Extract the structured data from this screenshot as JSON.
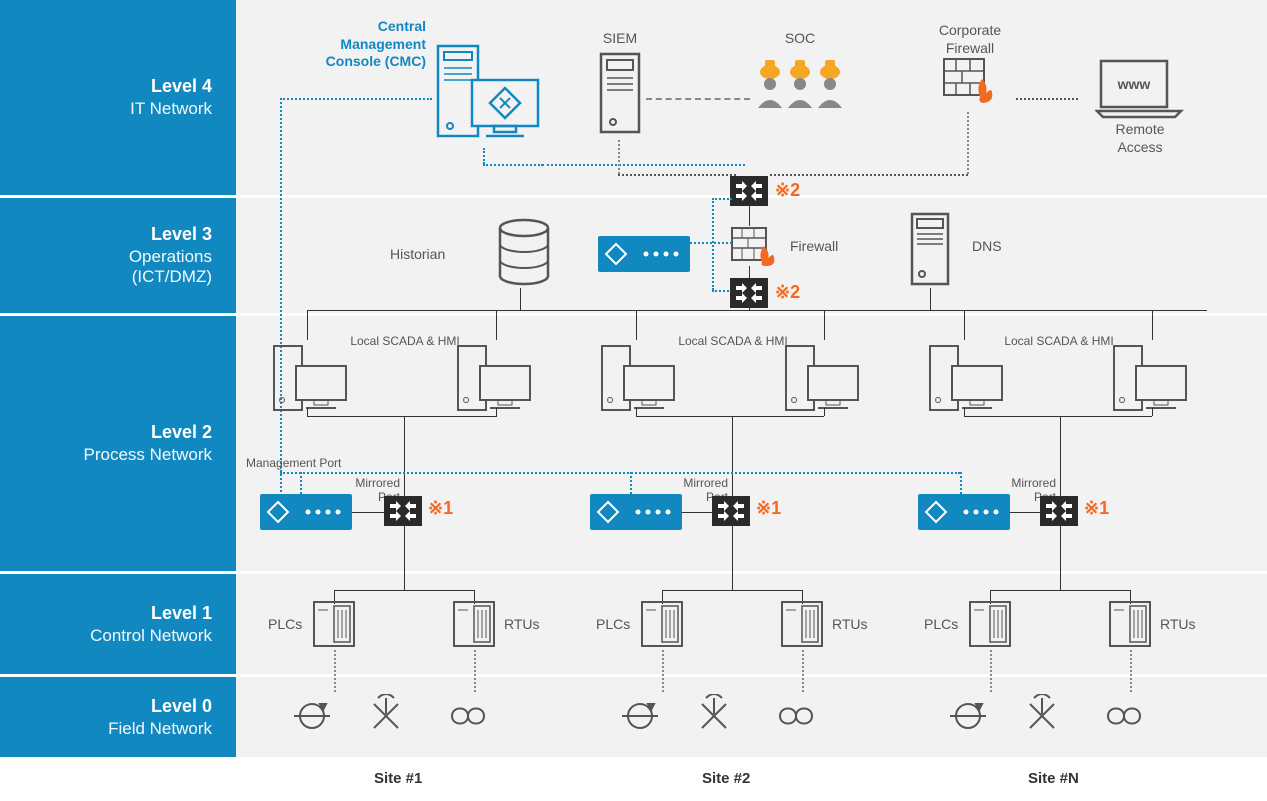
{
  "levels": {
    "l4": {
      "title": "Level 4",
      "subtitle": "IT Network"
    },
    "l3": {
      "title": "Level 3",
      "subtitle1": "Operations",
      "subtitle2": "(ICT/DMZ)"
    },
    "l2": {
      "title": "Level 2",
      "subtitle": "Process Network"
    },
    "l1": {
      "title": "Level 1",
      "subtitle": "Control Network"
    },
    "l0": {
      "title": "Level 0",
      "subtitle": "Field Network"
    }
  },
  "nodes": {
    "cmc": {
      "line1": "Central",
      "line2": "Management",
      "line3": "Console (CMC)"
    },
    "siem": "SIEM",
    "soc": "SOC",
    "corp_fw": {
      "line1": "Corporate",
      "line2": "Firewall"
    },
    "remote": {
      "glyph": "www",
      "line1": "Remote",
      "line2": "Access"
    },
    "historian": "Historian",
    "firewall": "Firewall",
    "dns": "DNS",
    "scada": "Local SCADA & HMI",
    "mgmt_port": "Management Port",
    "mirrored_port": "Mirrored Port",
    "plcs": "PLCs",
    "rtus": "RTUs"
  },
  "annotations": {
    "ref1": "※1",
    "ref2": "※2"
  },
  "sites": {
    "s1": "Site #1",
    "s2": "Site #2",
    "sn": "Site #N"
  }
}
